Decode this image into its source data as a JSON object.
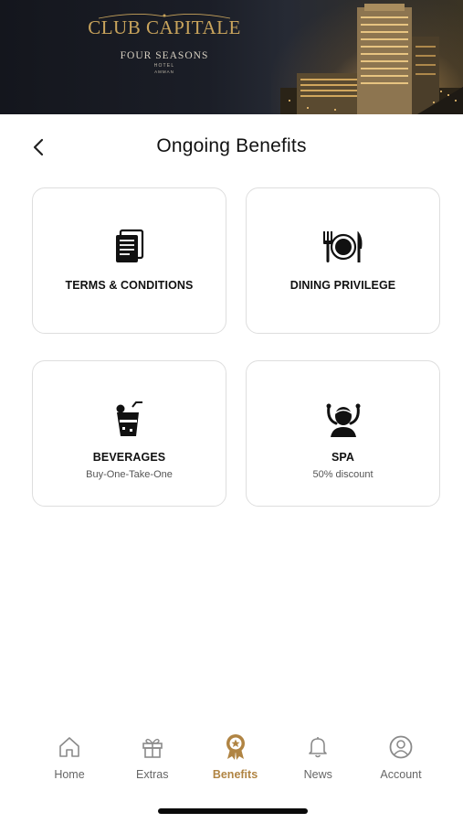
{
  "banner": {
    "brand_title": "CLUB CAPITALE",
    "hotel_name": "FOUR SEASONS",
    "hotel_word": "HOTEL",
    "city": "AMMAN",
    "accent_color": "#c9a45c"
  },
  "header": {
    "title": "Ongoing Benefits",
    "back_icon": "chevron-left-icon"
  },
  "benefits": [
    {
      "label": "TERMS & CONDITIONS",
      "subtitle": "",
      "icon": "document-icon"
    },
    {
      "label": "DINING PRIVILEGE",
      "subtitle": "",
      "icon": "plate-cutlery-icon"
    },
    {
      "label": "BEVERAGES",
      "subtitle": "Buy-One-Take-One",
      "icon": "drink-icon"
    },
    {
      "label": "SPA",
      "subtitle": "50% discount",
      "icon": "spa-person-icon"
    }
  ],
  "nav": {
    "active_color": "#b08443",
    "items": [
      {
        "label": "Home",
        "icon": "home-icon",
        "active": false
      },
      {
        "label": "Extras",
        "icon": "gift-icon",
        "active": false
      },
      {
        "label": "Benefits",
        "icon": "award-badge-icon",
        "active": true
      },
      {
        "label": "News",
        "icon": "bell-icon",
        "active": false
      },
      {
        "label": "Account",
        "icon": "user-circle-icon",
        "active": false
      }
    ]
  }
}
